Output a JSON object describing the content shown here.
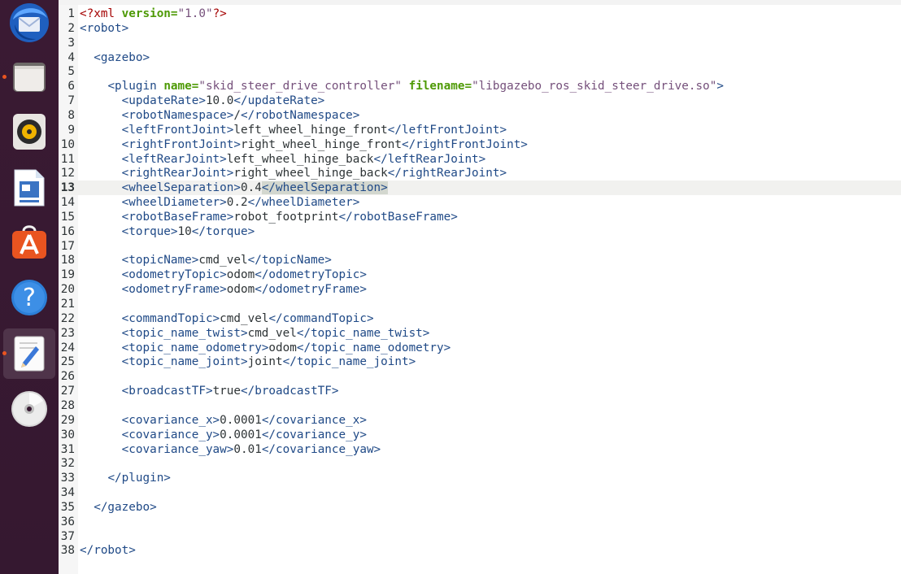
{
  "dock": {
    "items": [
      {
        "name": "thunderbird",
        "icon": "thunderbird-mail-icon",
        "running": false
      },
      {
        "name": "files",
        "icon": "files-folder-icon",
        "running": true
      },
      {
        "name": "rhythmbox",
        "icon": "rhythmbox-speaker-icon",
        "running": false
      },
      {
        "name": "writer",
        "icon": "libreoffice-writer-icon",
        "running": false
      },
      {
        "name": "software",
        "icon": "ubuntu-software-icon",
        "running": false
      },
      {
        "name": "help",
        "icon": "help-icon",
        "running": false
      },
      {
        "name": "text-editor",
        "icon": "text-editor-icon",
        "running": true,
        "active": true
      },
      {
        "name": "dvd",
        "icon": "optical-disc-icon",
        "running": false
      }
    ]
  },
  "editor": {
    "current_line": 13,
    "lines": [
      {
        "n": "1",
        "tokens": [
          [
            "pi",
            "<?xml"
          ],
          [
            "txt",
            " "
          ],
          [
            "attr",
            "version="
          ],
          [
            "str",
            "\"1.0\""
          ],
          [
            "pi",
            "?>"
          ]
        ]
      },
      {
        "n": "2",
        "tokens": [
          [
            "tag",
            "<robot>"
          ]
        ]
      },
      {
        "n": "3",
        "tokens": []
      },
      {
        "n": "4",
        "tokens": [
          [
            "txt",
            "  "
          ],
          [
            "tag",
            "<gazebo>"
          ]
        ]
      },
      {
        "n": "5",
        "tokens": []
      },
      {
        "n": "6",
        "tokens": [
          [
            "txt",
            "    "
          ],
          [
            "tag",
            "<plugin "
          ],
          [
            "attr",
            "name="
          ],
          [
            "str",
            "\"skid_steer_drive_controller\""
          ],
          [
            "txt",
            " "
          ],
          [
            "attr",
            "filename="
          ],
          [
            "str",
            "\"libgazebo_ros_skid_steer_drive.so\""
          ],
          [
            "tag",
            ">"
          ]
        ]
      },
      {
        "n": "7",
        "tokens": [
          [
            "txt",
            "      "
          ],
          [
            "tag",
            "<updateRate>"
          ],
          [
            "txt",
            "10.0"
          ],
          [
            "tag",
            "</updateRate>"
          ]
        ]
      },
      {
        "n": "8",
        "tokens": [
          [
            "txt",
            "      "
          ],
          [
            "tag",
            "<robotNamespace>"
          ],
          [
            "txt",
            "/"
          ],
          [
            "tag",
            "</robotNamespace>"
          ]
        ]
      },
      {
        "n": "9",
        "tokens": [
          [
            "txt",
            "      "
          ],
          [
            "tag",
            "<leftFrontJoint>"
          ],
          [
            "txt",
            "left_wheel_hinge_front"
          ],
          [
            "tag",
            "</leftFrontJoint>"
          ]
        ]
      },
      {
        "n": "10",
        "tokens": [
          [
            "txt",
            "      "
          ],
          [
            "tag",
            "<rightFrontJoint>"
          ],
          [
            "txt",
            "right_wheel_hinge_front"
          ],
          [
            "tag",
            "</rightFrontJoint>"
          ]
        ]
      },
      {
        "n": "11",
        "tokens": [
          [
            "txt",
            "      "
          ],
          [
            "tag",
            "<leftRearJoint>"
          ],
          [
            "txt",
            "left_wheel_hinge_back"
          ],
          [
            "tag",
            "</leftRearJoint>"
          ]
        ]
      },
      {
        "n": "12",
        "tokens": [
          [
            "txt",
            "      "
          ],
          [
            "tag",
            "<rightRearJoint>"
          ],
          [
            "txt",
            "right_wheel_hinge_back"
          ],
          [
            "tag",
            "</rightRearJoint>"
          ]
        ]
      },
      {
        "n": "13",
        "tokens": [
          [
            "txt",
            "      "
          ],
          [
            "tag",
            "<wheelSeparation>"
          ],
          [
            "txt",
            "0.4"
          ],
          [
            "tagbm",
            "<"
          ],
          [
            "tagbm",
            "/wheelSeparation"
          ],
          [
            "tagbm",
            ">"
          ]
        ]
      },
      {
        "n": "14",
        "tokens": [
          [
            "txt",
            "      "
          ],
          [
            "tag",
            "<wheelDiameter>"
          ],
          [
            "txt",
            "0.2"
          ],
          [
            "tag",
            "</wheelDiameter>"
          ]
        ]
      },
      {
        "n": "15",
        "tokens": [
          [
            "txt",
            "      "
          ],
          [
            "tag",
            "<robotBaseFrame>"
          ],
          [
            "txt",
            "robot_footprint"
          ],
          [
            "tag",
            "</robotBaseFrame>"
          ]
        ]
      },
      {
        "n": "16",
        "tokens": [
          [
            "txt",
            "      "
          ],
          [
            "tag",
            "<torque>"
          ],
          [
            "txt",
            "10"
          ],
          [
            "tag",
            "</torque>"
          ]
        ]
      },
      {
        "n": "17",
        "tokens": []
      },
      {
        "n": "18",
        "tokens": [
          [
            "txt",
            "      "
          ],
          [
            "tag",
            "<topicName>"
          ],
          [
            "txt",
            "cmd_vel"
          ],
          [
            "tag",
            "</topicName>"
          ]
        ]
      },
      {
        "n": "19",
        "tokens": [
          [
            "txt",
            "      "
          ],
          [
            "tag",
            "<odometryTopic>"
          ],
          [
            "txt",
            "odom"
          ],
          [
            "tag",
            "</odometryTopic>"
          ]
        ]
      },
      {
        "n": "20",
        "tokens": [
          [
            "txt",
            "      "
          ],
          [
            "tag",
            "<odometryFrame>"
          ],
          [
            "txt",
            "odom"
          ],
          [
            "tag",
            "</odometryFrame>"
          ]
        ]
      },
      {
        "n": "21",
        "tokens": []
      },
      {
        "n": "22",
        "tokens": [
          [
            "txt",
            "      "
          ],
          [
            "tag",
            "<commandTopic>"
          ],
          [
            "txt",
            "cmd_vel"
          ],
          [
            "tag",
            "</commandTopic>"
          ]
        ]
      },
      {
        "n": "23",
        "tokens": [
          [
            "txt",
            "      "
          ],
          [
            "tag",
            "<topic_name_twist>"
          ],
          [
            "txt",
            "cmd_vel"
          ],
          [
            "tag",
            "</topic_name_twist>"
          ]
        ]
      },
      {
        "n": "24",
        "tokens": [
          [
            "txt",
            "      "
          ],
          [
            "tag",
            "<topic_name_odometry>"
          ],
          [
            "txt",
            "odom"
          ],
          [
            "tag",
            "</topic_name_odometry>"
          ]
        ]
      },
      {
        "n": "25",
        "tokens": [
          [
            "txt",
            "      "
          ],
          [
            "tag",
            "<topic_name_joint>"
          ],
          [
            "txt",
            "joint"
          ],
          [
            "tag",
            "</topic_name_joint>"
          ]
        ]
      },
      {
        "n": "26",
        "tokens": []
      },
      {
        "n": "27",
        "tokens": [
          [
            "txt",
            "      "
          ],
          [
            "tag",
            "<broadcastTF>"
          ],
          [
            "txt",
            "true"
          ],
          [
            "tag",
            "</broadcastTF>"
          ]
        ]
      },
      {
        "n": "28",
        "tokens": []
      },
      {
        "n": "29",
        "tokens": [
          [
            "txt",
            "      "
          ],
          [
            "tag",
            "<covariance_x>"
          ],
          [
            "txt",
            "0.0001"
          ],
          [
            "tag",
            "</covariance_x>"
          ]
        ]
      },
      {
        "n": "30",
        "tokens": [
          [
            "txt",
            "      "
          ],
          [
            "tag",
            "<covariance_y>"
          ],
          [
            "txt",
            "0.0001"
          ],
          [
            "tag",
            "</covariance_y>"
          ]
        ]
      },
      {
        "n": "31",
        "tokens": [
          [
            "txt",
            "      "
          ],
          [
            "tag",
            "<covariance_yaw>"
          ],
          [
            "txt",
            "0.01"
          ],
          [
            "tag",
            "</covariance_yaw>"
          ]
        ]
      },
      {
        "n": "32",
        "tokens": []
      },
      {
        "n": "33",
        "tokens": [
          [
            "txt",
            "    "
          ],
          [
            "tag",
            "</plugin>"
          ]
        ]
      },
      {
        "n": "34",
        "tokens": []
      },
      {
        "n": "35",
        "tokens": [
          [
            "txt",
            "  "
          ],
          [
            "tag",
            "</gazebo>"
          ]
        ]
      },
      {
        "n": "36",
        "tokens": []
      },
      {
        "n": "37",
        "tokens": []
      },
      {
        "n": "38",
        "tokens": [
          [
            "tag",
            "</robot>"
          ]
        ]
      }
    ]
  },
  "colors": {
    "dock_bg": "#3a1a33",
    "tag": "#204a87",
    "attr": "#4e9a06",
    "string": "#75507b",
    "text": "#2e3436",
    "processing_instruction": "#a40000",
    "running_indicator": "#e95420"
  }
}
